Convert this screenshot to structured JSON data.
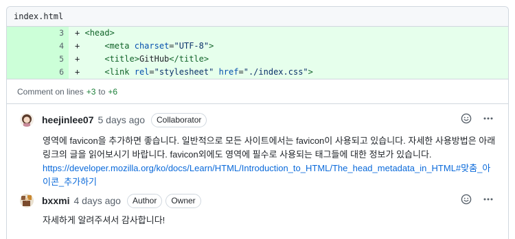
{
  "file": {
    "name": "index.html"
  },
  "diff": {
    "lines": [
      {
        "num": "3",
        "sign": "+",
        "indent": " ",
        "parts": [
          {
            "t": "tag",
            "v": "<head>"
          }
        ]
      },
      {
        "num": "4",
        "sign": "+",
        "indent": "     ",
        "parts": [
          {
            "t": "tag",
            "v": "<meta "
          },
          {
            "t": "attr",
            "v": "charset"
          },
          {
            "t": "plain",
            "v": "="
          },
          {
            "t": "str",
            "v": "\"UTF-8\""
          },
          {
            "t": "tag",
            "v": ">"
          }
        ]
      },
      {
        "num": "5",
        "sign": "+",
        "indent": "     ",
        "parts": [
          {
            "t": "tag",
            "v": "<title>"
          },
          {
            "t": "plain",
            "v": "GitHub"
          },
          {
            "t": "tag",
            "v": "</title>"
          }
        ]
      },
      {
        "num": "6",
        "sign": "+",
        "indent": "     ",
        "parts": [
          {
            "t": "tag",
            "v": "<link "
          },
          {
            "t": "attr",
            "v": "rel"
          },
          {
            "t": "plain",
            "v": "="
          },
          {
            "t": "str",
            "v": "\"stylesheet\""
          },
          {
            "t": "plain",
            "v": " "
          },
          {
            "t": "attr",
            "v": "href"
          },
          {
            "t": "plain",
            "v": "="
          },
          {
            "t": "str",
            "v": "\"./index.css\""
          },
          {
            "t": "tag",
            "v": ">"
          }
        ]
      }
    ]
  },
  "comment_on": {
    "prefix": "Comment on lines",
    "from": "+3",
    "to_label": "to",
    "to": "+6"
  },
  "comments": [
    {
      "author": "heejinlee07",
      "time": "5 days ago",
      "badges": [
        "Collaborator"
      ],
      "body_text": "영역에 favicon을 추가하면 좋습니다. 일반적으로 모든 사이트에서는 favicon이 사용되고 있습니다. 자세한 사용방법은 아래 링크의 글을 읽어보시기 바랍니다. favicon외에도 영역에 필수로 사용되는 태그들에 대한 정보가 있습니다.",
      "link": "https://developer.mozilla.org/ko/docs/Learn/HTML/Introduction_to_HTML/The_head_metadata_in_HTML#맞춤_아이콘_추가하기"
    },
    {
      "author": "bxxmi",
      "time": "4 days ago",
      "badges": [
        "Author",
        "Owner"
      ],
      "body_text": "자세하게 알려주셔서 감사합니다!",
      "link": ""
    }
  ],
  "icons": {
    "reaction": "smiley-icon",
    "menu": "kebab-horizontal-icon"
  },
  "colors": {
    "added_bg": "#e6ffec",
    "added_gutter": "#ccffd8",
    "link": "#0969da",
    "added_num": "#1a7f37"
  }
}
